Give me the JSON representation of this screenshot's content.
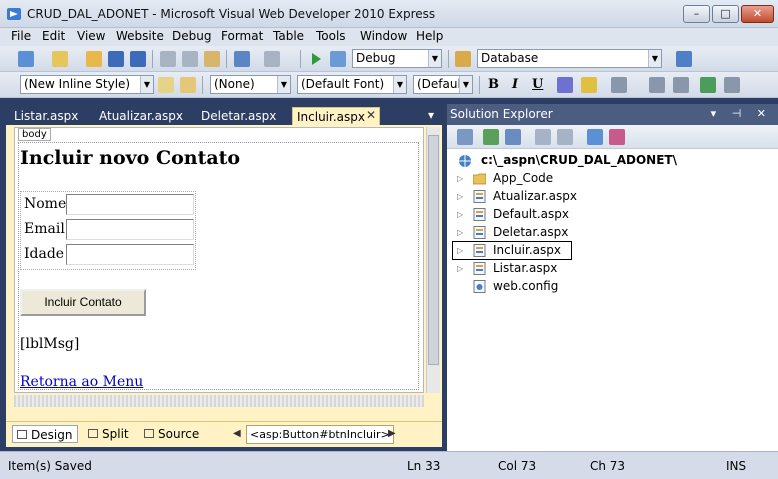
{
  "window": {
    "title": "CRUD_DAL_ADONET - Microsoft Visual Web Developer 2010 Express",
    "min_glyph": "–",
    "max_glyph": "□",
    "close_glyph": "✕"
  },
  "menu": [
    "File",
    "Edit",
    "View",
    "Website",
    "Debug",
    "Format",
    "Table",
    "Tools",
    "Window",
    "Help"
  ],
  "toolbar": {
    "config_combo": "Debug",
    "target_combo": "Database",
    "style_combo": "(New Inline Style)",
    "block_combo": "(None)",
    "font_combo": "(Default Font)",
    "size_combo": "(Default",
    "bold": "B",
    "italic": "I",
    "underline": "U"
  },
  "tabs": [
    {
      "label": "Listar.aspx",
      "active": false
    },
    {
      "label": "Atualizar.aspx",
      "active": false
    },
    {
      "label": "Deletar.aspx",
      "active": false
    },
    {
      "label": "Incluir.aspx",
      "active": true
    }
  ],
  "design": {
    "body_tag": "body",
    "heading": "Incluir novo Contato",
    "fields": [
      {
        "label": "Nome",
        "value": ""
      },
      {
        "label": "Email",
        "value": ""
      },
      {
        "label": "Idade",
        "value": ""
      }
    ],
    "button": "Incluir Contato",
    "message_label": "[lblMsg]",
    "menu_link": "Retorna ao Menu"
  },
  "view_tabs": [
    {
      "label": "Design",
      "active": true
    },
    {
      "label": "Split",
      "active": false
    },
    {
      "label": "Source",
      "active": false
    }
  ],
  "tag_path": "<asp:Button#btnIncluir>",
  "solution_explorer": {
    "title": "Solution Explorer",
    "header_icons": "▾ ⊣ ✕",
    "root": "c:\\_aspn\\CRUD_DAL_ADONET\\",
    "items": [
      {
        "label": "App_Code",
        "icon": "folder-icon",
        "expandable": true,
        "selected": false
      },
      {
        "label": "Atualizar.aspx",
        "icon": "aspx-file-icon",
        "expandable": true,
        "selected": false
      },
      {
        "label": "Default.aspx",
        "icon": "aspx-file-icon",
        "expandable": true,
        "selected": false
      },
      {
        "label": "Deletar.aspx",
        "icon": "aspx-file-icon",
        "expandable": true,
        "selected": false
      },
      {
        "label": "Incluir.aspx",
        "icon": "aspx-file-icon",
        "expandable": true,
        "selected": true
      },
      {
        "label": "Listar.aspx",
        "icon": "aspx-file-icon",
        "expandable": true,
        "selected": false
      },
      {
        "label": "web.config",
        "icon": "config-file-icon",
        "expandable": false,
        "selected": false
      }
    ]
  },
  "status": {
    "message": "Item(s) Saved",
    "line": "Ln 33",
    "col": "Col 73",
    "ch": "Ch 73",
    "mode": "INS"
  },
  "colors": {
    "accent": "#2c3e63",
    "editor_bg": "#fff3c6",
    "link": "#0000cc"
  }
}
